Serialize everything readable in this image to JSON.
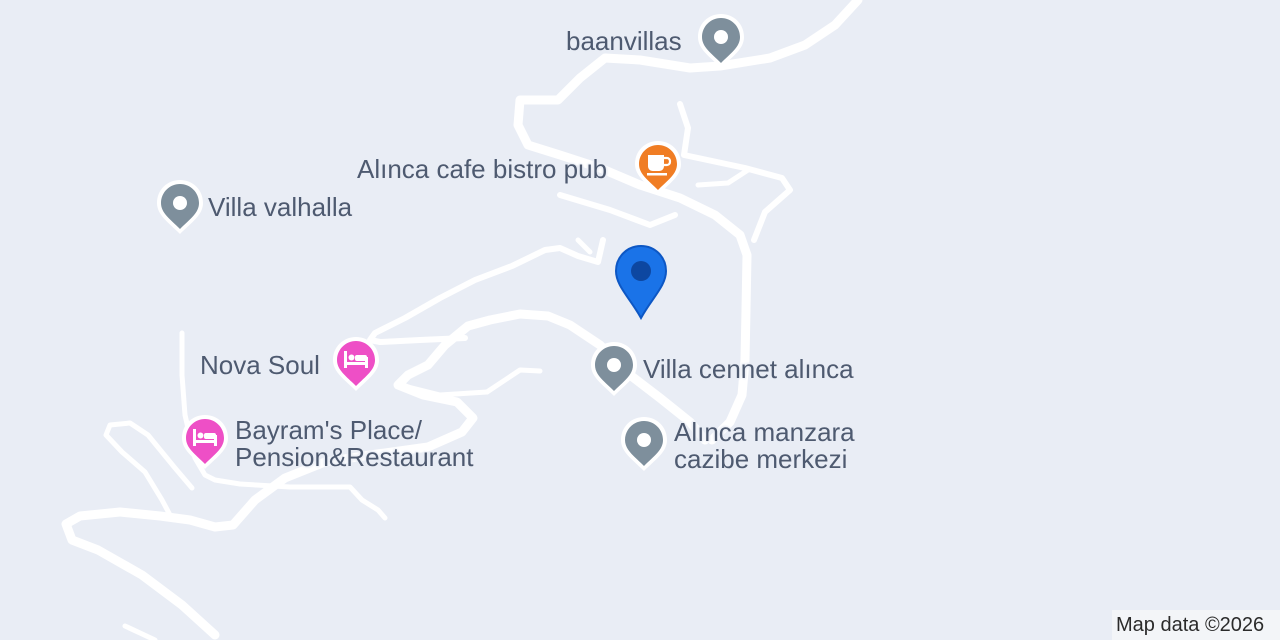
{
  "map": {
    "attribution": "Map data ©2026",
    "colors": {
      "background": "#e9edf5",
      "road": "#ffffff",
      "label": "#4e5a70",
      "generic_pin": "#7e8f9c",
      "cafe_pin": "#f07d24",
      "lodging_pin": "#ee4fc6",
      "location_pin": "#1a73e8"
    },
    "location_marker": {
      "icon": "location-pin-icon"
    },
    "pois": [
      {
        "name": "baanvillas",
        "category": "generic",
        "icon": "place-pin-icon"
      },
      {
        "name": "Alınca cafe bistro pub",
        "category": "cafe",
        "icon": "coffee-cup-icon"
      },
      {
        "name": "Villa valhalla",
        "category": "generic",
        "icon": "place-pin-icon"
      },
      {
        "name": "Nova Soul",
        "category": "lodging",
        "icon": "bed-icon"
      },
      {
        "name": "Bayram's Place/",
        "name_line2": "Pension&Restaurant",
        "category": "lodging",
        "icon": "bed-icon"
      },
      {
        "name": "Villa cennet alınca",
        "category": "generic",
        "icon": "place-pin-icon"
      },
      {
        "name": "Alınca manzara",
        "name_line2": "cazibe merkezi",
        "category": "generic",
        "icon": "place-pin-icon"
      }
    ]
  }
}
